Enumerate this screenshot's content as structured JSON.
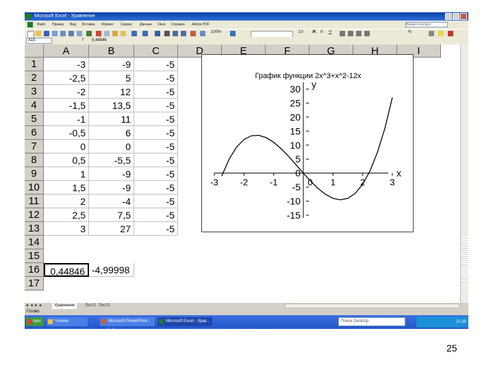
{
  "window": {
    "title": "Microsoft Excel - Уравнение"
  },
  "menubar": {
    "items": [
      "Файл",
      "Правка",
      "Вид",
      "Вставка",
      "Формат",
      "Сервис",
      "Данные",
      "Окно",
      "Справка",
      "Adobe PDF"
    ],
    "help_placeholder": "Введите вопрос"
  },
  "toolbar": {
    "font_size": "10",
    "currency_label": "%",
    "zoom": "100%"
  },
  "formulabar": {
    "name_box": "A15",
    "fx_label": "f",
    "value": "0,44846"
  },
  "sheet": {
    "columns": [
      "A",
      "B",
      "C",
      "D",
      "E",
      "F",
      "G",
      "H",
      "I"
    ],
    "rows": [
      "1",
      "2",
      "3",
      "4",
      "5",
      "6",
      "7",
      "8",
      "9",
      "10",
      "11",
      "12",
      "13",
      "14",
      "15",
      "16",
      "17"
    ],
    "data": [
      [
        "-3",
        "-9",
        "-5"
      ],
      [
        "-2,5",
        "5",
        "-5"
      ],
      [
        "-2",
        "12",
        "-5"
      ],
      [
        "-1,5",
        "13,5",
        "-5"
      ],
      [
        "-1",
        "11",
        "-5"
      ],
      [
        "-0,5",
        "6",
        "-5"
      ],
      [
        "0",
        "0",
        "-5"
      ],
      [
        "0,5",
        "-5,5",
        "-5"
      ],
      [
        "1",
        "-9",
        "-5"
      ],
      [
        "1,5",
        "-9",
        "-5"
      ],
      [
        "2",
        "-4",
        "-5"
      ],
      [
        "2,5",
        "7,5",
        "-5"
      ],
      [
        "3",
        "27",
        "-5"
      ]
    ],
    "row15": {
      "a": "0,44846",
      "b": "-4,99998"
    }
  },
  "chart_data": {
    "type": "line",
    "title": "График функции 2x^3+x^2-12x",
    "xlabel": "x",
    "ylabel": "y",
    "x_ticks": [
      "-3",
      "-2",
      "-1",
      "0",
      "1",
      "2",
      "3"
    ],
    "y_ticks": [
      "30",
      "25",
      "20",
      "15",
      "10",
      "5",
      "0",
      "-5",
      "-10",
      "-15"
    ],
    "xlim": [
      -3,
      3
    ],
    "ylim": [
      -15,
      30
    ],
    "series": [
      {
        "x": [
          -2.75,
          -2.5,
          -2.25,
          -2,
          -1.75,
          -1.5,
          -1.25,
          -1,
          -0.75,
          -0.5,
          -0.25,
          0,
          0.25,
          0.5,
          0.75,
          1,
          1.25,
          1.5,
          1.75,
          2,
          2.25,
          2.5,
          2.75,
          3
        ],
        "y": [
          -1.03,
          5,
          9.28,
          12,
          13.34,
          13.5,
          12.66,
          11,
          8.72,
          6,
          3.03,
          0,
          -2.91,
          -5.5,
          -7.59,
          -9,
          -9.53,
          -9,
          -7.22,
          -4,
          0.84,
          7.5,
          16.09,
          27
        ]
      }
    ]
  },
  "tabbar": {
    "sheet_tab": "Уравнение",
    "tab2": "Лист2",
    "tab3": "Лист3"
  },
  "statusbar": {
    "text": "Готово"
  },
  "taskbar": {
    "start": "пуск",
    "buttons": [
      "Чтения",
      "Microsoft PowerPoint - [...]",
      "Microsoft Excel - Урав..."
    ],
    "search_placeholder": "Поиск Desktop",
    "clock": "21:35"
  },
  "page_number": "25"
}
